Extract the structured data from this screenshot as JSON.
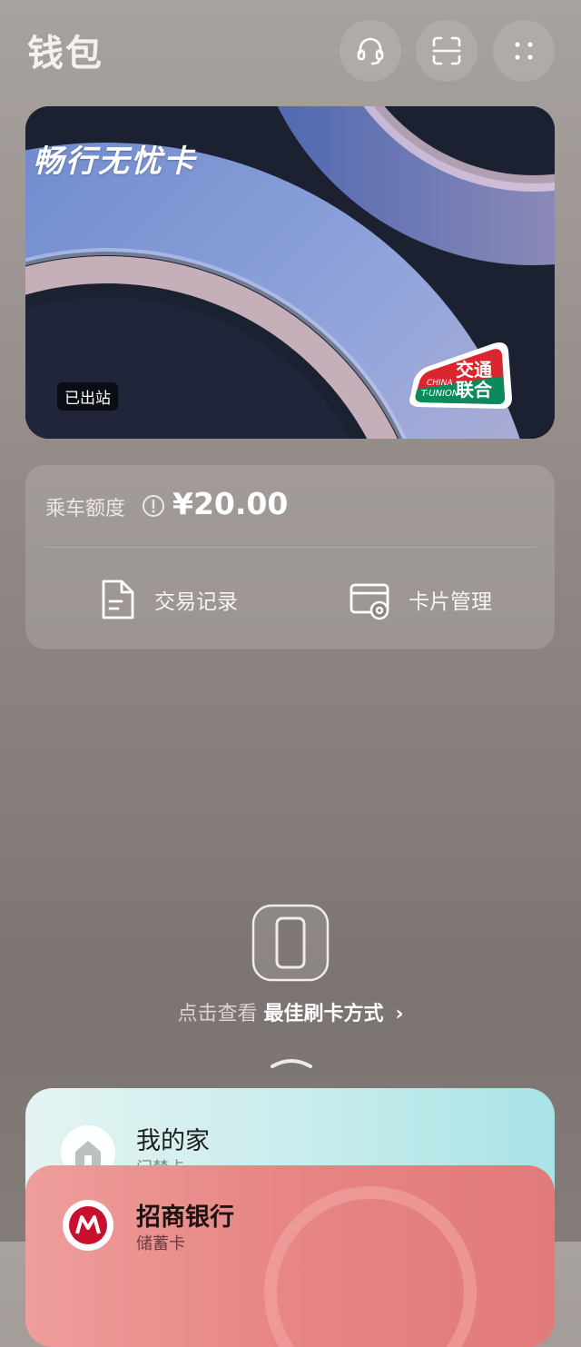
{
  "header": {
    "title": "钱包"
  },
  "card": {
    "name": "畅行无忧卡",
    "status": "已出站",
    "logo_top": "交通",
    "logo_bottom": "联合",
    "logo_small_1": "CHINA",
    "logo_small_2": "T-UNION"
  },
  "balance": {
    "label": "乘车额度",
    "value": "¥20.00"
  },
  "actions": {
    "records_label": "交易记录",
    "manage_label": "卡片管理"
  },
  "hint": {
    "prefix": "点击查看",
    "link": "最佳刷卡方式",
    "chevron": "›"
  },
  "stack": {
    "home_name": "我的家",
    "home_sub": "门禁卡",
    "bank_name": "招商银行",
    "bank_sub": "储蓄卡"
  },
  "icons": {
    "support": "headset-icon",
    "scan": "scan-icon",
    "more": "dots-grid-icon",
    "info": "info-icon",
    "records": "document-icon",
    "manage": "card-settings-icon",
    "phone": "phone-icon",
    "handle": "chevron-up-icon"
  }
}
